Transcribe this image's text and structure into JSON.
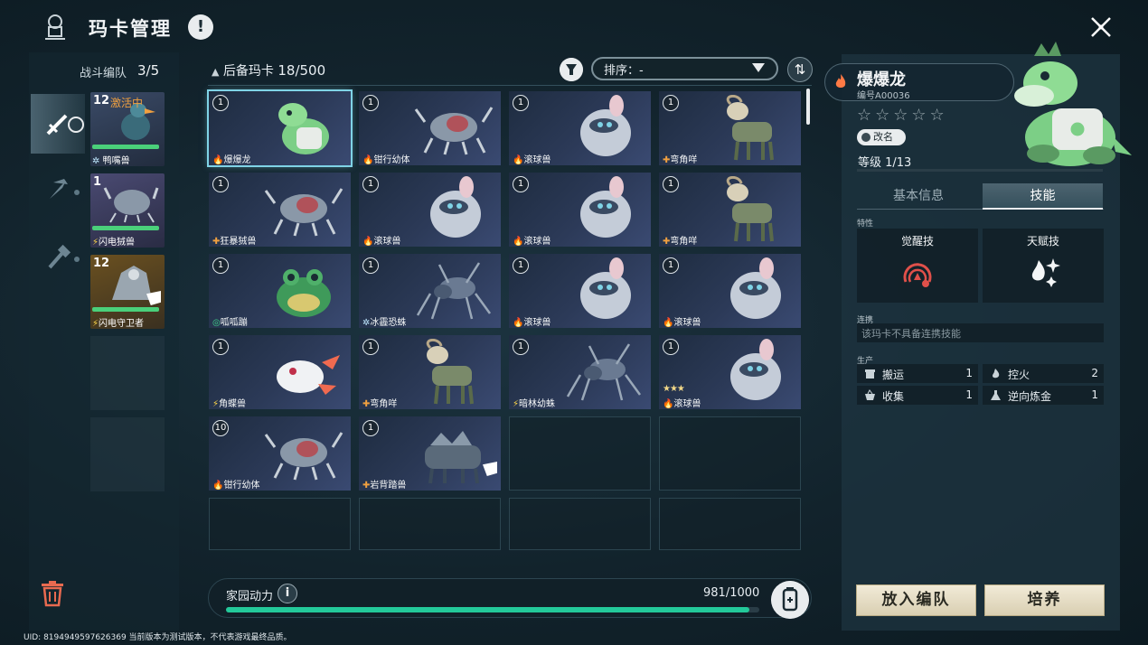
{
  "header": {
    "title": "玛卡管理",
    "info_icon": "exclamation-icon",
    "close_icon": "close-icon"
  },
  "team": {
    "label": "战斗编队",
    "count": "3/5",
    "tabs": [
      "sword-icon",
      "pickaxe-icon",
      "hammer-icon"
    ],
    "cards": [
      {
        "level": "12",
        "status": "激活中",
        "name": "鸭嘴兽",
        "element": "ice",
        "hp": 0.95
      },
      {
        "level": "1",
        "status": "",
        "name": "闪电狨兽",
        "element": "electric",
        "hp": 0.95
      },
      {
        "level": "12",
        "status": "",
        "name": "闪电守卫者",
        "element": "electric",
        "hp": 0.95
      }
    ]
  },
  "reserve": {
    "label": "后备玛卡",
    "count": "18/500",
    "sort_label": "排序：-",
    "cards": [
      {
        "level": "1",
        "name": "爆爆龙",
        "element": "fire",
        "creature": "dino",
        "selected": true
      },
      {
        "level": "1",
        "name": "钳行幼体",
        "element": "fire",
        "creature": "crab"
      },
      {
        "level": "1",
        "name": "滚球兽",
        "element": "fire",
        "creature": "ball"
      },
      {
        "level": "1",
        "name": "弯角咩",
        "element": "cross",
        "creature": "goat"
      },
      {
        "level": "1",
        "name": "狂暴狨兽",
        "element": "cross",
        "creature": "crab"
      },
      {
        "level": "1",
        "name": "滚球兽",
        "element": "fire",
        "creature": "ball"
      },
      {
        "level": "1",
        "name": "滚球兽",
        "element": "fire",
        "creature": "ball"
      },
      {
        "level": "1",
        "name": "弯角咩",
        "element": "cross",
        "creature": "goat"
      },
      {
        "level": "1",
        "name": "呱呱蹦",
        "element": "wind",
        "creature": "frog"
      },
      {
        "level": "1",
        "name": "冰霾恐蛛",
        "element": "ice",
        "creature": "spider"
      },
      {
        "level": "1",
        "name": "滚球兽",
        "element": "fire",
        "creature": "ball"
      },
      {
        "level": "1",
        "name": "滚球兽",
        "element": "fire",
        "creature": "ball"
      },
      {
        "level": "1",
        "name": "角蝶兽",
        "element": "electric",
        "creature": "axolotl"
      },
      {
        "level": "1",
        "name": "弯角咩",
        "element": "cross",
        "creature": "goat"
      },
      {
        "level": "1",
        "name": "暗林幼蛛",
        "element": "electric",
        "creature": "spider"
      },
      {
        "level": "1",
        "name": "滚球兽",
        "element": "fire",
        "creature": "ball",
        "stars": "★★★"
      },
      {
        "level": "10",
        "name": "钳行幼体",
        "element": "fire",
        "creature": "crab"
      },
      {
        "level": "1",
        "name": "岩背踏兽",
        "element": "cross",
        "creature": "boar",
        "badge": true
      }
    ]
  },
  "energy": {
    "label": "家园动力",
    "value_text": "981/1000",
    "fraction": 0.981
  },
  "uid_text": "UID: 8194949597626369 当前版本为测试版本，不代表游戏最终品质。",
  "detail": {
    "name": "爆爆龙",
    "id": "编号A00036",
    "stars": "☆☆☆☆☆",
    "rename": "改名",
    "level": "等级 1/13",
    "tabs": {
      "basic": "基本信息",
      "skill": "技能"
    },
    "trait_label": "特性",
    "skills": [
      {
        "title": "觉醒技",
        "icon": "awaken-skill-icon"
      },
      {
        "title": "天赋技",
        "icon": "talent-skill-icon"
      }
    ],
    "combo_label": "连携",
    "combo_text": "该玛卡不具备连携技能",
    "prod_label": "生产",
    "production": [
      {
        "name": "搬运",
        "value": "1",
        "icon": "carry-icon"
      },
      {
        "name": "控火",
        "value": "2",
        "icon": "fire-control-icon"
      },
      {
        "name": "收集",
        "value": "1",
        "icon": "collect-icon"
      },
      {
        "name": "逆向炼金",
        "value": "1",
        "icon": "alchemy-icon"
      }
    ],
    "buttons": {
      "team": "放入编队",
      "train": "培养"
    }
  },
  "colors": {
    "fire": "#ff7a45",
    "electric": "#ffd84a",
    "ice": "#bfe8ff",
    "wind": "#3fd48a",
    "cross": "#f0a040",
    "accent": "#7fd3e6",
    "energy": "#23c99a"
  }
}
